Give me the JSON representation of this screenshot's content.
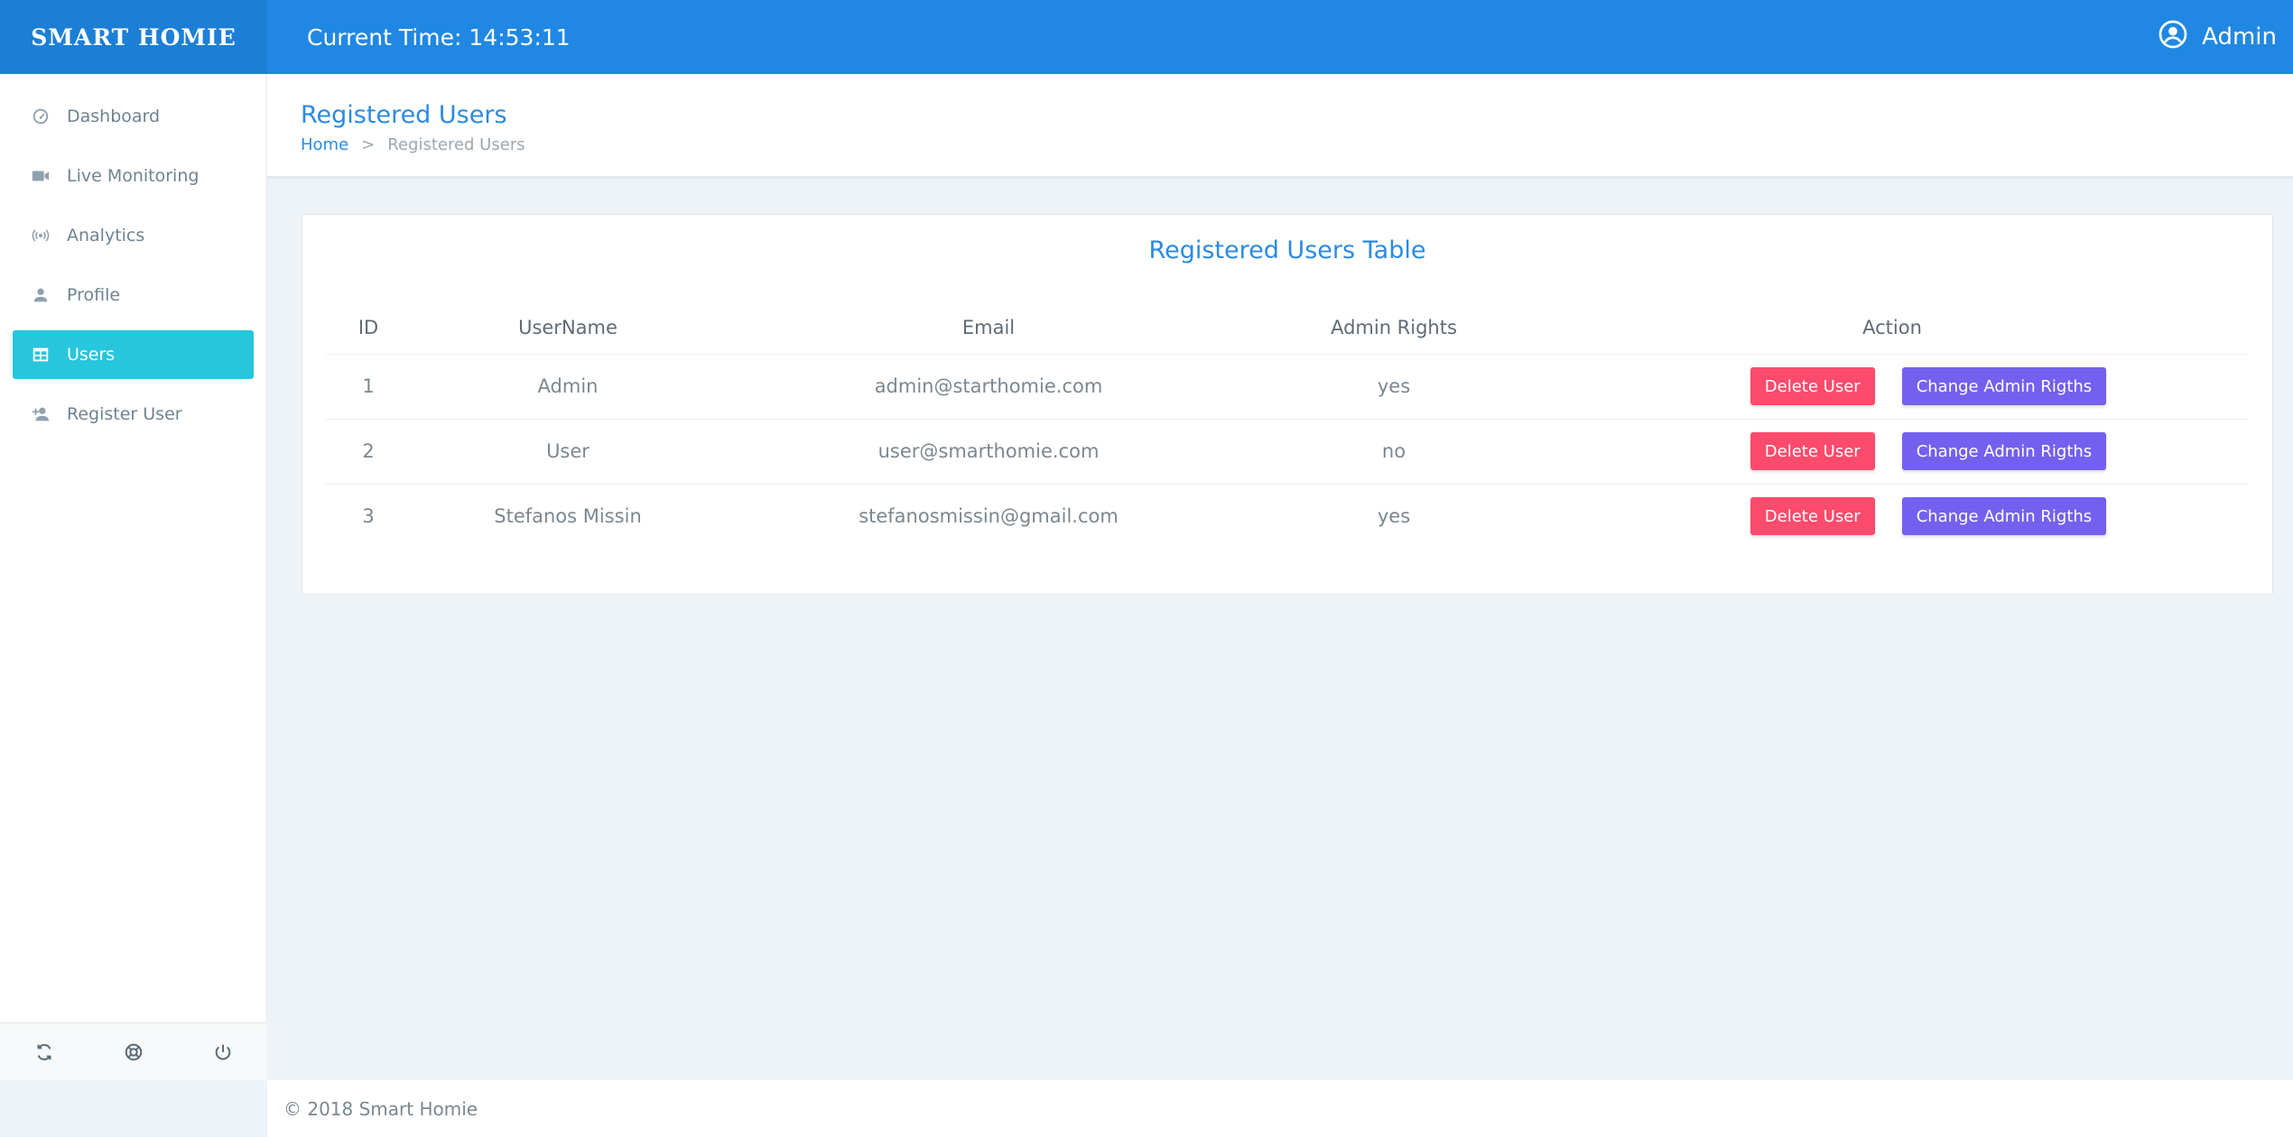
{
  "brand": "SMART HOMIE",
  "header": {
    "clock_label": "Current Time:",
    "clock_value": "14:53:11",
    "user_name": "Admin"
  },
  "sidebar": {
    "items": [
      {
        "label": "Dashboard",
        "icon": "dashboard-icon"
      },
      {
        "label": "Live Monitoring",
        "icon": "video-camera-icon"
      },
      {
        "label": "Analytics",
        "icon": "broadcast-icon"
      },
      {
        "label": "Profile",
        "icon": "person-icon"
      },
      {
        "label": "Users",
        "icon": "table-icon",
        "active": true
      },
      {
        "label": "Register User",
        "icon": "add-user-icon"
      }
    ],
    "footer_icons": [
      "refresh-icon",
      "lifebuoy-icon",
      "power-icon"
    ]
  },
  "page": {
    "title": "Registered Users",
    "breadcrumb": {
      "home": "Home",
      "separator": ">",
      "current": "Registered Users"
    }
  },
  "card": {
    "title": "Registered Users Table",
    "columns": [
      "ID",
      "UserName",
      "Email",
      "Admin Rights",
      "Action"
    ],
    "rows": [
      {
        "id": "1",
        "username": "Admin",
        "email": "admin@starthomie.com",
        "admin": "yes"
      },
      {
        "id": "2",
        "username": "User",
        "email": "user@smarthomie.com",
        "admin": "no"
      },
      {
        "id": "3",
        "username": "Stefanos Missin",
        "email": "stefanosmissin@gmail.com",
        "admin": "yes"
      }
    ],
    "delete_label": "Delete User",
    "change_label": "Change Admin Rigths"
  },
  "footer": {
    "text": "© 2018 Smart Homie"
  },
  "colors": {
    "topbar": "#2088e2",
    "active": "#27c6dc",
    "danger": "#fc4b6c",
    "purple": "#7460ee",
    "accent_text": "#2b8ae0"
  }
}
